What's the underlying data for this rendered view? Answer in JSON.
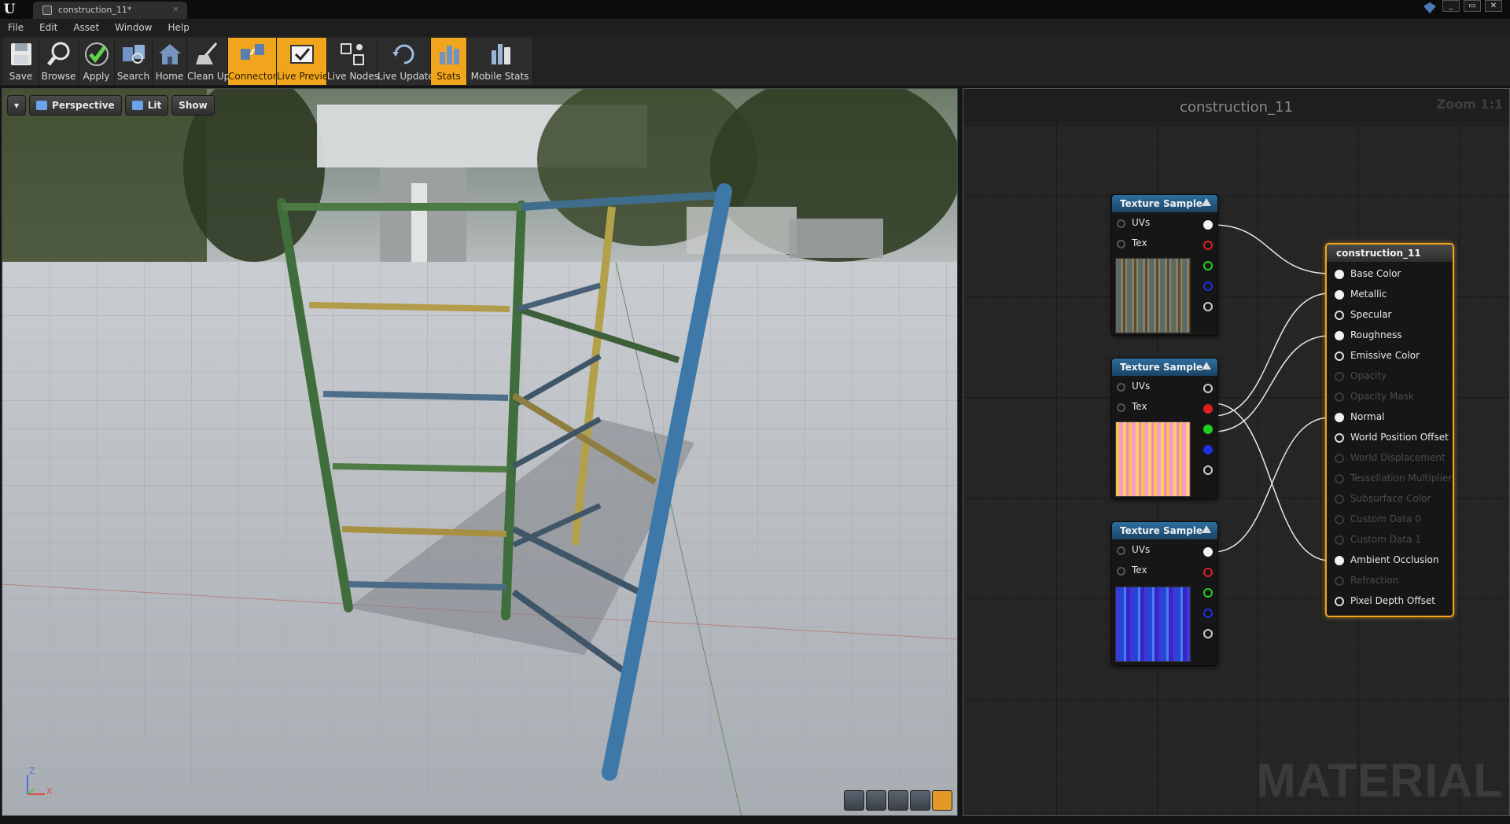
{
  "window": {
    "tab_title": "construction_11*",
    "tab_close": "×",
    "controls": [
      "_",
      "▭",
      "✕"
    ]
  },
  "menu": [
    "File",
    "Edit",
    "Asset",
    "Window",
    "Help"
  ],
  "toolbar": [
    {
      "label": "Save",
      "icon": "save-icon",
      "active": false
    },
    {
      "label": "Browse",
      "icon": "browse-icon",
      "active": false
    },
    {
      "label": "Apply",
      "icon": "apply-icon",
      "active": false
    },
    {
      "label": "Search",
      "icon": "search-icon",
      "active": false
    },
    {
      "label": "Home",
      "icon": "home-icon",
      "active": false
    },
    {
      "label": "Clean Up",
      "icon": "clean-up-icon",
      "active": false
    },
    {
      "label": "Connectors",
      "icon": "connectors-icon",
      "active": true
    },
    {
      "label": "Live Preview",
      "icon": "live-preview-icon",
      "active": true
    },
    {
      "label": "Live Nodes",
      "icon": "live-nodes-icon",
      "active": false
    },
    {
      "label": "Live Update",
      "icon": "live-update-icon",
      "active": false
    },
    {
      "label": "Stats",
      "icon": "stats-icon",
      "active": true
    },
    {
      "label": "Mobile Stats",
      "icon": "mobile-stats-icon",
      "active": false
    }
  ],
  "viewport": {
    "perspective_label": "Perspective",
    "lit_label": "Lit",
    "show_label": "Show",
    "axis_z": "Z",
    "axis_x": "X"
  },
  "graph": {
    "title": "construction_11",
    "zoom": "Zoom 1:1",
    "watermark": "MATERIAL"
  },
  "texture_nodes": [
    {
      "title": "Texture Sample",
      "inputs": [
        "UVs",
        "Tex"
      ]
    },
    {
      "title": "Texture Sample",
      "inputs": [
        "UVs",
        "Tex"
      ]
    },
    {
      "title": "Texture Sample",
      "inputs": [
        "UVs",
        "Tex"
      ]
    }
  ],
  "result_node": {
    "title": "construction_11",
    "inputs": [
      {
        "label": "Base Color",
        "enabled": true,
        "connected": true
      },
      {
        "label": "Metallic",
        "enabled": true,
        "connected": true
      },
      {
        "label": "Specular",
        "enabled": true,
        "connected": false
      },
      {
        "label": "Roughness",
        "enabled": true,
        "connected": true
      },
      {
        "label": "Emissive Color",
        "enabled": true,
        "connected": false
      },
      {
        "label": "Opacity",
        "enabled": false,
        "connected": false
      },
      {
        "label": "Opacity Mask",
        "enabled": false,
        "connected": false
      },
      {
        "label": "Normal",
        "enabled": true,
        "connected": true
      },
      {
        "label": "World Position Offset",
        "enabled": true,
        "connected": false
      },
      {
        "label": "World Displacement",
        "enabled": false,
        "connected": false
      },
      {
        "label": "Tessellation Multiplier",
        "enabled": false,
        "connected": false
      },
      {
        "label": "Subsurface Color",
        "enabled": false,
        "connected": false
      },
      {
        "label": "Custom Data 0",
        "enabled": false,
        "connected": false
      },
      {
        "label": "Custom Data 1",
        "enabled": false,
        "connected": false
      },
      {
        "label": "Ambient Occlusion",
        "enabled": true,
        "connected": true
      },
      {
        "label": "Refraction",
        "enabled": false,
        "connected": false
      },
      {
        "label": "Pixel Depth Offset",
        "enabled": true,
        "connected": false
      }
    ]
  },
  "colors": {
    "accent": "#f1a51c",
    "node_header": "#2d6f9e",
    "pin_red": "#e02020",
    "pin_green": "#20d020",
    "pin_blue": "#2030e0"
  }
}
